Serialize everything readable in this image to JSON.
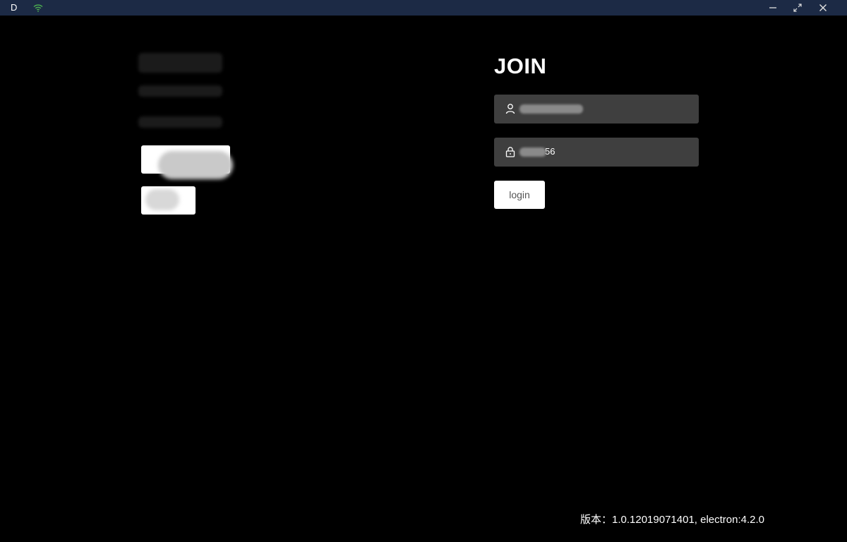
{
  "titlebar": {
    "app_letter": "D",
    "icons": [
      "wifi-icon",
      "minimize-icon",
      "maximize-icon",
      "close-icon"
    ],
    "background": "#1c2a45",
    "wifi_color": "#4caf50"
  },
  "join": {
    "title": "JOIN",
    "username": {
      "icon": "user-icon",
      "value": ""
    },
    "password": {
      "icon": "lock-icon",
      "value": "56"
    },
    "login_label": "login"
  },
  "footer": {
    "version": "版本：1.0.12019071401, electron:4.2.0"
  }
}
